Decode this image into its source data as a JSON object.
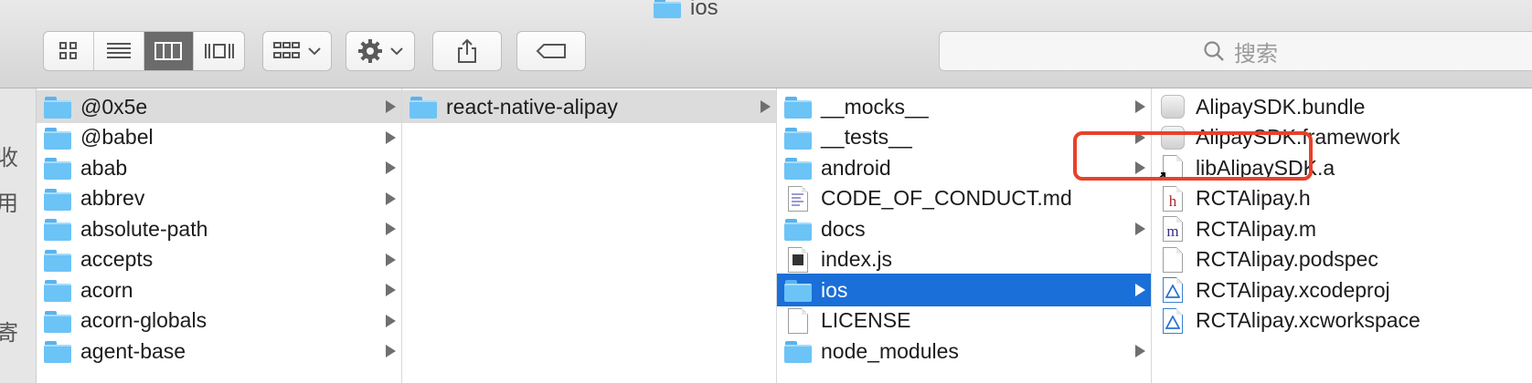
{
  "window": {
    "title": "ios"
  },
  "toolbar": {
    "views": [
      "icon-view",
      "list-view",
      "column-view",
      "gallery-view"
    ],
    "search_placeholder": "搜索"
  },
  "sidebar": {
    "glyphs": [
      "收",
      "用",
      "寄"
    ]
  },
  "columns": [
    {
      "rows": [
        {
          "label": "@0x5e",
          "kind": "folder",
          "arrow": true,
          "state": "selected-inactive"
        },
        {
          "label": "@babel",
          "kind": "folder",
          "arrow": true
        },
        {
          "label": "abab",
          "kind": "folder",
          "arrow": true
        },
        {
          "label": "abbrev",
          "kind": "folder",
          "arrow": true
        },
        {
          "label": "absolute-path",
          "kind": "folder",
          "arrow": true
        },
        {
          "label": "accepts",
          "kind": "folder",
          "arrow": true
        },
        {
          "label": "acorn",
          "kind": "folder",
          "arrow": true
        },
        {
          "label": "acorn-globals",
          "kind": "folder",
          "arrow": true
        },
        {
          "label": "agent-base",
          "kind": "folder",
          "arrow": true
        }
      ]
    },
    {
      "rows": [
        {
          "label": "react-native-alipay",
          "kind": "folder",
          "arrow": true,
          "state": "selected-inactive"
        }
      ]
    },
    {
      "rows": [
        {
          "label": "__mocks__",
          "kind": "folder",
          "arrow": true
        },
        {
          "label": "__tests__",
          "kind": "folder",
          "arrow": true
        },
        {
          "label": "android",
          "kind": "folder",
          "arrow": true
        },
        {
          "label": "CODE_OF_CONDUCT.md",
          "kind": "text-doc",
          "arrow": false
        },
        {
          "label": "docs",
          "kind": "folder",
          "arrow": true
        },
        {
          "label": "index.js",
          "kind": "js-doc",
          "arrow": false
        },
        {
          "label": "ios",
          "kind": "folder",
          "arrow": true,
          "state": "selected-active"
        },
        {
          "label": "LICENSE",
          "kind": "doc",
          "arrow": false
        },
        {
          "label": "node_modules",
          "kind": "folder",
          "arrow": true
        }
      ]
    },
    {
      "rows": [
        {
          "label": "AlipaySDK.bundle",
          "kind": "bundle",
          "arrow": false
        },
        {
          "label": "AlipaySDK.framework",
          "kind": "bundle",
          "arrow": false
        },
        {
          "label": "libAlipaySDK.a",
          "kind": "alias-doc",
          "arrow": false
        },
        {
          "label": "RCTAlipay.h",
          "kind": "h-doc",
          "glyph": "h",
          "arrow": false
        },
        {
          "label": "RCTAlipay.m",
          "kind": "m-doc",
          "glyph": "m",
          "arrow": false
        },
        {
          "label": "RCTAlipay.podspec",
          "kind": "doc",
          "arrow": false
        },
        {
          "label": "RCTAlipay.xcodeproj",
          "kind": "xcode",
          "arrow": false
        },
        {
          "label": "RCTAlipay.xcworkspace",
          "kind": "xcode",
          "arrow": false
        }
      ]
    }
  ],
  "annotation": {
    "highlighted_item": "libAlipaySDK.a",
    "color": "#e8412b"
  }
}
